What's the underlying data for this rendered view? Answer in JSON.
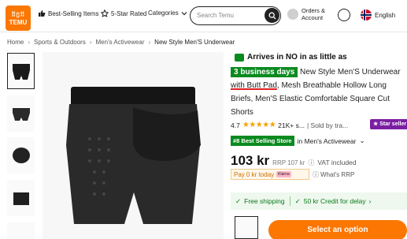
{
  "header": {
    "logo_line1": "TEMU",
    "logo_line2": "TEMU",
    "nav": {
      "best_selling": "Best-Selling Items",
      "five_star": "5-Star Rated",
      "categories": "Categories"
    },
    "search_placeholder": "Search Temu",
    "orders_line1": "Orders &",
    "orders_line2": "Account",
    "language": "English"
  },
  "breadcrumb": {
    "items": [
      "Home",
      "Sports & Outdoors",
      "Men's Activewear",
      "New Style Men'S Underwear"
    ],
    "separator": "›"
  },
  "product": {
    "arrival": "Arrives in NO in as little as",
    "days_badge": "3 business days",
    "title_part1": "New Style Men'S Underwear",
    "title_pad": "with Butt Pad",
    "title_part2": ", Mesh Breathable Hollow Long Briefs, Men'S Elastic Comfortable Square Cut Shorts",
    "rating_value": "4.7",
    "stars": "★★★★★",
    "reviews": "21K+ s...",
    "sold_by": "| Sold by tra...",
    "star_seller": "Star seller",
    "best_seller_badge": "#8 Best Selling Store",
    "best_seller_category": "in Men's Activewear",
    "price": "103 kr",
    "rrp": "RRP 107 kr",
    "vat": "VAT included",
    "pay_later": "Pay 0 kr today",
    "klarna": "Klarna",
    "whats_rrp": "What's RRP",
    "free_shipping": "Free shipping",
    "credit": "50 kr Credit for delay",
    "select_option": "Select an option"
  },
  "colors": {
    "brand": "#fb7701",
    "green": "#0a8a1f",
    "star": "#f5a100"
  }
}
